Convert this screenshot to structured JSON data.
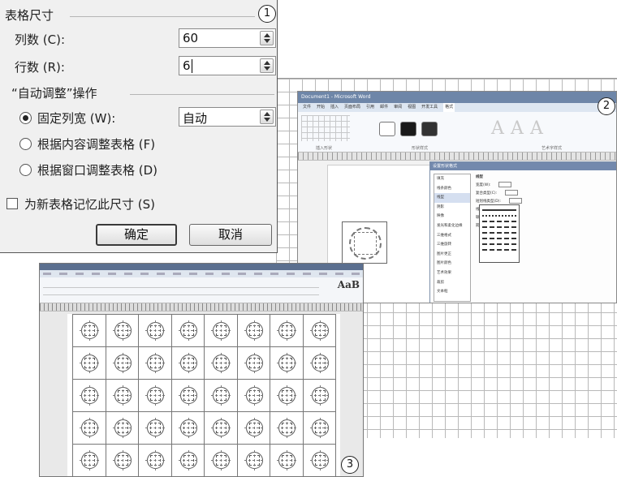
{
  "badges": {
    "one": "1",
    "two": "2",
    "three": "3"
  },
  "dialog1": {
    "section_size": "表格尺寸",
    "columns_label": "列数 (C):",
    "columns_value": "60",
    "rows_label": "行数 (R):",
    "rows_value": "6",
    "section_autofit": "“自动调整”操作",
    "fixed_width_label": "固定列宽 (W):",
    "fixed_width_value": "自动",
    "fit_content_label": "根据内容调整表格 (F)",
    "fit_window_label": "根据窗口调整表格 (D)",
    "remember_label": "为新表格记忆此尺寸 (S)",
    "ok_label": "确定",
    "cancel_label": "取消",
    "selected_option": "fixed_width",
    "remember_checked": false
  },
  "shot2": {
    "title": "Document1 - Microsoft Word",
    "tabs": [
      "文件",
      "开始",
      "插入",
      "页面布局",
      "引用",
      "邮件",
      "审阅",
      "视图",
      "开发工具",
      "格式"
    ],
    "active_tab": "格式",
    "groups": [
      "插入形状",
      "形状样式",
      "艺术字样式"
    ],
    "dialog_title": "设置形状格式",
    "sidebar": [
      "填充",
      "线条颜色",
      "线型",
      "阴影",
      "映像",
      "发光和柔化边缘",
      "三维格式",
      "三维旋转",
      "图片更正",
      "图片颜色",
      "艺术效果",
      "裁剪",
      "文本框"
    ],
    "sidebar_selected": "线型",
    "panel_title": "线型",
    "panel_rows": [
      "宽度(W):",
      "复合类型(C):",
      "短划线类型(D):",
      "线端类型(A):",
      "联接类型(J):",
      "箭头设置"
    ]
  },
  "shot3": {
    "table_rows": 5,
    "table_cols": 8
  }
}
